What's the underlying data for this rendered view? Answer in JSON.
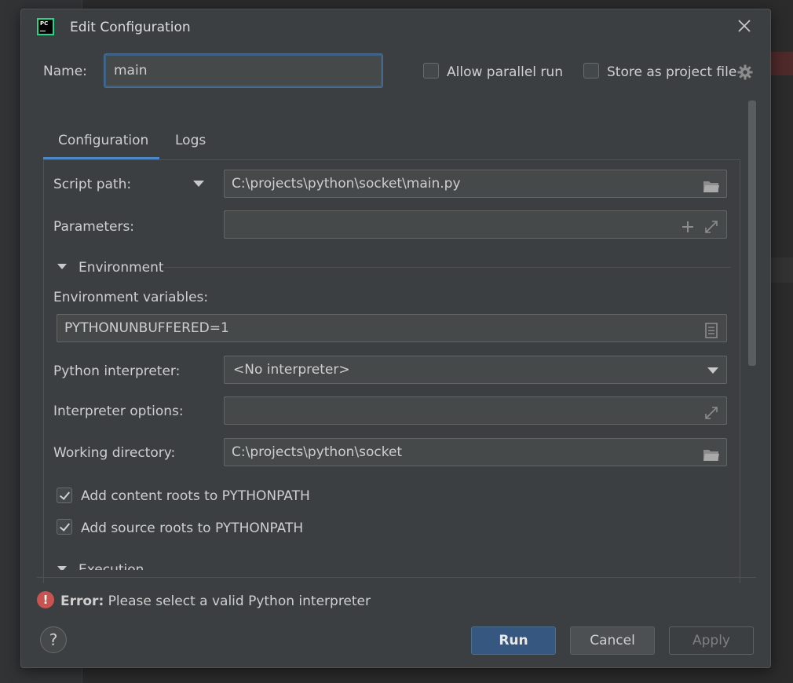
{
  "background": {
    "code_snippet": ""
  },
  "dialog": {
    "title": "Edit Configuration",
    "app_logo_text": "PC",
    "name_label": "Name:",
    "name_value": "main",
    "allow_parallel_label": "Allow parallel run",
    "allow_parallel_checked": false,
    "store_project_label": "Store as project file",
    "store_project_checked": false
  },
  "tabs": [
    {
      "label": "Configuration",
      "active": true
    },
    {
      "label": "Logs",
      "active": false
    }
  ],
  "config": {
    "script_path_label": "Script path:",
    "script_path_value": "C:\\projects\\python\\socket\\main.py",
    "parameters_label": "Parameters:",
    "parameters_value": "",
    "environment_section": "Environment",
    "env_vars_label": "Environment variables:",
    "env_vars_value": "PYTHONUNBUFFERED=1",
    "interpreter_label": "Python interpreter:",
    "interpreter_value": "<No interpreter>",
    "interp_options_label": "Interpreter options:",
    "interp_options_value": "",
    "working_dir_label": "Working directory:",
    "working_dir_value": "C:\\projects\\python\\socket",
    "content_roots_label": "Add content roots to PYTHONPATH",
    "content_roots_checked": true,
    "source_roots_label": "Add source roots to PYTHONPATH",
    "source_roots_checked": true,
    "execution_section": "Execution"
  },
  "footer": {
    "error_prefix": "Error:",
    "error_message": "Please select a valid Python interpreter",
    "help_label": "?",
    "run_label": "Run",
    "cancel_label": "Cancel",
    "apply_label": "Apply"
  },
  "colors": {
    "accent": "#4a88c7",
    "primary_button": "#365880",
    "error": "#c75450",
    "dialog_bg": "#3c3f41"
  }
}
